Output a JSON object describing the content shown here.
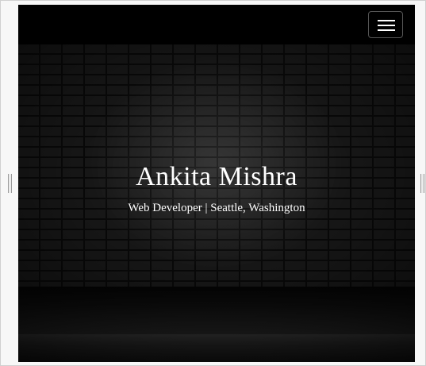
{
  "navbar": {
    "menu_icon": "hamburger-menu-icon"
  },
  "hero": {
    "name": "Ankita Mishra",
    "subtitle": "Web Developer | Seattle, Washington",
    "background": "dark-brick-wall"
  },
  "colors": {
    "navbar_bg": "#000000",
    "text": "#ffffff",
    "frame_bg": "#f7f7f7"
  }
}
